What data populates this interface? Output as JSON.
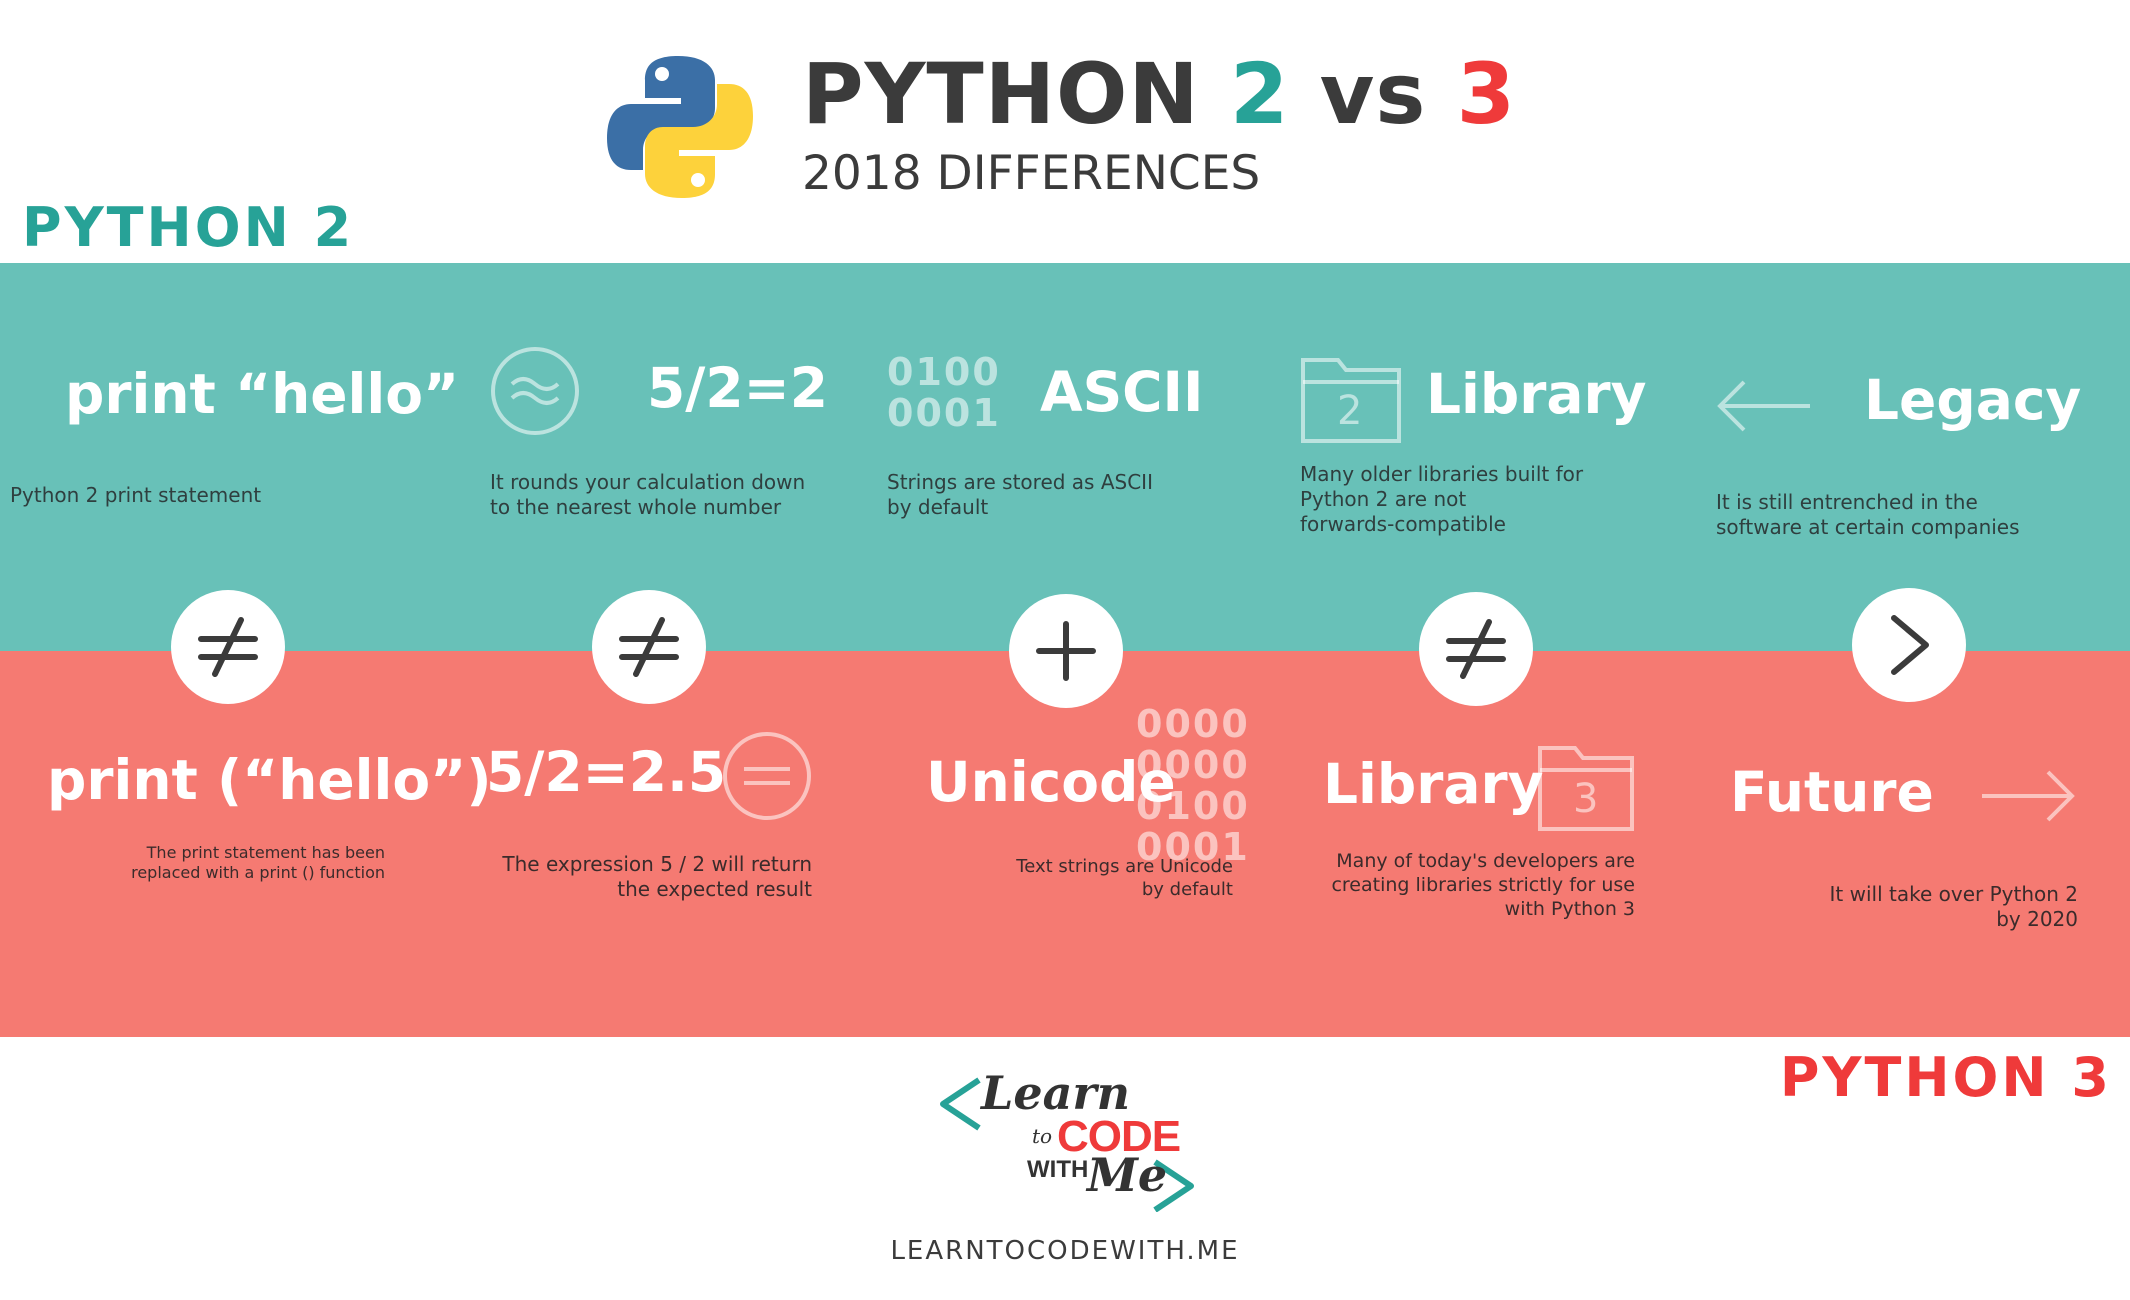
{
  "header": {
    "title_prefix": "PYTHON ",
    "title_v2": "2",
    "title_vs": " vs ",
    "title_v3": "3",
    "subtitle": "2018 DIFFERENCES"
  },
  "labels": {
    "python2": "PYTHON 2",
    "python3": "PYTHON 3"
  },
  "colors": {
    "teal": "#68c1b8",
    "teal_text": "#27a297",
    "red": "#f57a72",
    "red_text": "#ef3a3a",
    "dark": "#3b3b3b"
  },
  "python2": [
    {
      "heading": "print “hello”",
      "desc": "Python 2 print statement",
      "icon": "none"
    },
    {
      "heading": "5/2=2",
      "desc_l1": "It rounds your calculation down",
      "desc_l2": "to the nearest whole number",
      "icon": "approx-icon"
    },
    {
      "heading": "ASCII",
      "bits_l1": "0100",
      "bits_l2": "0001",
      "desc_l1": "Strings are stored as ASCII",
      "desc_l2": "by default",
      "icon": "binary"
    },
    {
      "heading": "Library",
      "folder_num": "2",
      "desc_l1": "Many older libraries built for",
      "desc_l2": "Python 2 are not",
      "desc_l3": "forwards-compatible",
      "icon": "folder-icon"
    },
    {
      "heading": "Legacy",
      "desc_l1": "It is still entrenched in the",
      "desc_l2": "software at certain companies",
      "icon": "arrow-left-icon"
    }
  ],
  "python3": [
    {
      "heading": "print (“hello”)",
      "desc_l1": "The print statement has been",
      "desc_l2": "replaced with a print () function"
    },
    {
      "heading": "5/2=2.5",
      "desc_l1": "The expression 5 / 2 will return",
      "desc_l2": "the expected result",
      "icon": "equals-icon"
    },
    {
      "heading": "Unicode",
      "bits_l1": "0000",
      "bits_l2": "0000",
      "bits_l3": "0100",
      "bits_l4": "0001",
      "desc_l1": "Text strings are Unicode",
      "desc_l2": "by default"
    },
    {
      "heading": "Library",
      "folder_num": "3",
      "desc_l1": "Many of today's developers are",
      "desc_l2": "creating libraries strictly for use",
      "desc_l3": "with Python 3",
      "icon": "folder-icon"
    },
    {
      "heading": "Future",
      "desc_l1": "It will take over Python 2",
      "desc_l2": "by 2020",
      "icon": "arrow-right-icon"
    }
  ],
  "comparisons": [
    "not-equal-icon",
    "not-equal-icon",
    "plus-icon",
    "not-equal-icon",
    "greater-than-icon"
  ],
  "footer": {
    "logo_learn": "Learn",
    "logo_to": "to",
    "logo_code": "CODE",
    "logo_with": "WITH",
    "logo_me": "Me",
    "url": "LEARNTOCODEWITH.ME"
  }
}
